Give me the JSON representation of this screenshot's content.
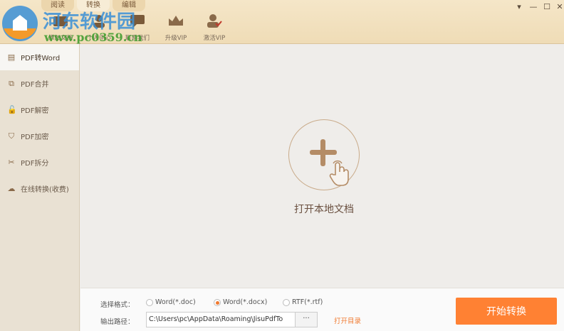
{
  "tabs": [
    {
      "label": "阅读"
    },
    {
      "label": "转换"
    },
    {
      "label": "编辑"
    }
  ],
  "toolbar": [
    {
      "label": "添加文档",
      "icon": "folder-icon"
    },
    {
      "label": "个人中心",
      "icon": "user-icon"
    },
    {
      "label": "联系我们",
      "icon": "chat-icon"
    },
    {
      "label": "升级VIP",
      "icon": "crown-icon"
    },
    {
      "label": "激活VIP",
      "icon": "user-check-icon"
    }
  ],
  "window": {
    "menu": "▾",
    "minimize": "—",
    "maximize": "☐",
    "close": "✕"
  },
  "watermark": {
    "name": "河东软件园",
    "url": "www.pc0359.cn"
  },
  "sidebar": {
    "items": [
      {
        "label": "PDF转Word",
        "icon": "▤"
      },
      {
        "label": "PDF合并",
        "icon": "⧉"
      },
      {
        "label": "PDF解密",
        "icon": "🔓"
      },
      {
        "label": "PDF加密",
        "icon": "⛉"
      },
      {
        "label": "PDF拆分",
        "icon": "✂"
      },
      {
        "label": "在线转换(收费)",
        "icon": "☁"
      }
    ]
  },
  "main": {
    "open_label": "打开本地文档"
  },
  "bottom": {
    "format_label": "选择格式：",
    "formats": [
      {
        "label": "Word(*.doc)",
        "selected": false
      },
      {
        "label": "Word(*.docx)",
        "selected": true
      },
      {
        "label": "RTF(*.rtf)",
        "selected": false
      }
    ],
    "path_label": "输出路径：",
    "path_value": "C:\\Users\\pc\\AppData\\Roaming\\JisuPdfTo",
    "browse": "···",
    "open_dir": "打开目录",
    "start": "开始转换"
  },
  "colors": {
    "accent": "#ff8133"
  }
}
